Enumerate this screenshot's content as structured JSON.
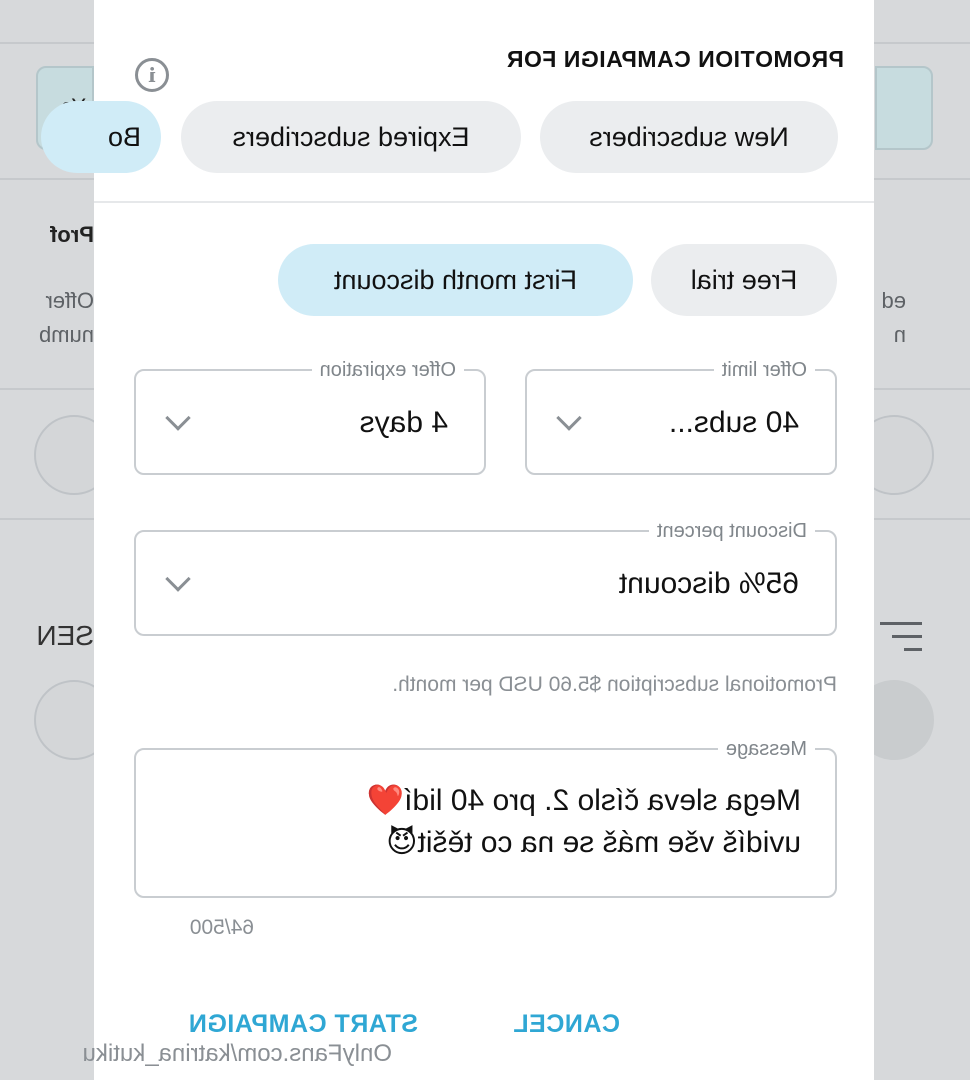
{
  "modal": {
    "title": "PROMOTION CAMPAIGN FOR",
    "info_icon": "info-icon",
    "audience_chips": [
      "New subscribers",
      "Expired subscribers",
      "Bo"
    ],
    "offer_type_chips": [
      "Free trial",
      "First month discount"
    ],
    "offer_limit": {
      "label": "Offer limit",
      "value": "40 subs..."
    },
    "offer_expiration": {
      "label": "Offer expiration",
      "value": "4 days"
    },
    "discount_percent": {
      "label": "Discount percent",
      "value": "65% discount"
    },
    "promo_note": "Promotional subscription $5.60 USD per month.",
    "message": {
      "label": "Message",
      "line1": "Mega sleva číslo 2. pro 40 lidí❤️",
      "line2": "uvidíš vše máš se na co těšit😈"
    },
    "char_counter": "64/500",
    "cancel_label": "CANCEL",
    "start_label": "START CAMPAIGN"
  },
  "background": {
    "tab_partial": "Yo",
    "section_title_partial": "Prof",
    "desc_line1_partial": "Offer",
    "desc_line2_partial": "numb",
    "desc_right_partial": "ed",
    "desc_right_partial2": "n",
    "section2_partial": "SEN"
  },
  "watermark": "OnlyFans.com/katrina_kutiku",
  "colors": {
    "accent": "#2fa7d4",
    "chip_selected": "#d0ecf7",
    "chip_default": "#ebedef"
  }
}
